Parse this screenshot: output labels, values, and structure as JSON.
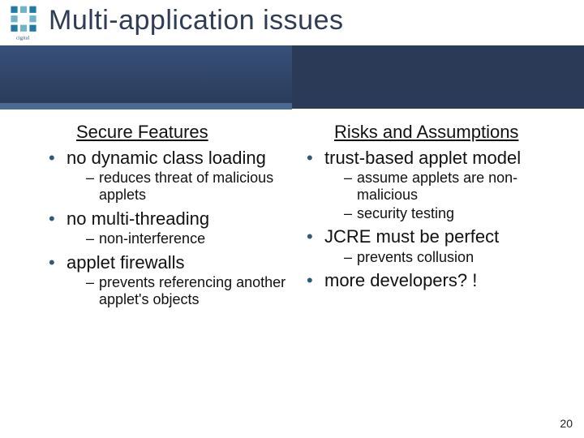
{
  "brand": {
    "name": "cigital"
  },
  "title": "Multi-application issues",
  "left": {
    "heading": "Secure Features",
    "b1_0": "no dynamic class loading",
    "b1_0_s0": "reduces threat of malicious applets",
    "b1_1": "no multi-threading",
    "b1_1_s0": "non-interference",
    "b1_2": "applet firewalls",
    "b1_2_s0": "prevents referencing another applet's objects"
  },
  "right": {
    "heading": "Risks and Assumptions",
    "b1_0": "trust-based applet model",
    "b1_0_s0": "assume applets are non-malicious",
    "b1_0_s1": "security testing",
    "b1_1": "JCRE must be perfect",
    "b1_1_s0": "prevents collusion",
    "b1_2": "more developers? !"
  },
  "page_number": "20"
}
